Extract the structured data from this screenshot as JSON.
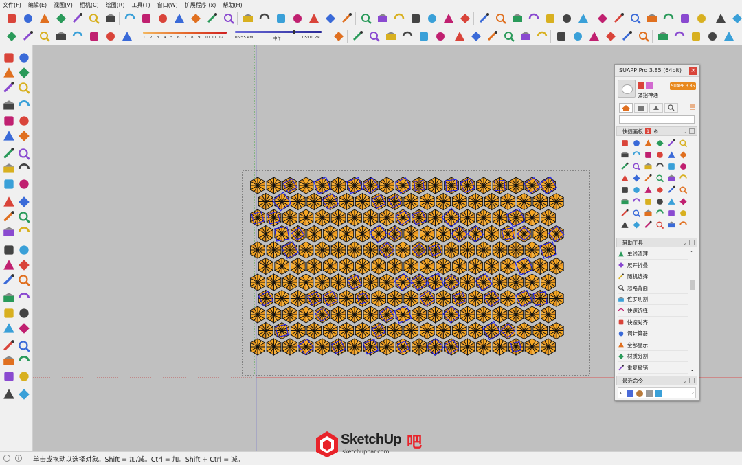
{
  "menu": [
    "文件(F)",
    "编辑(E)",
    "视图(V)",
    "相机(C)",
    "绘图(R)",
    "工具(T)",
    "窗口(W)",
    "扩展程序 (x)",
    "帮助(H)"
  ],
  "shadow_slider": {
    "hours": [
      "1",
      "2",
      "3",
      "4",
      "5",
      "6",
      "7",
      "8",
      "9",
      "10",
      "11",
      "12"
    ]
  },
  "time_slider": {
    "start": "06:55 AM",
    "mid": "中午",
    "end": "05:00 PM"
  },
  "status": {
    "hint": "单击或拖动以选择对象。Shift = 加/减。Ctrl = 加。Shift + Ctrl = 减。"
  },
  "suapp": {
    "title": "SUAPP Pro 3.85 (64bit)",
    "badge": "SUAPP 3.85",
    "user": "弹指神通",
    "section_quick": "快捷画板",
    "section_quick_num": "1",
    "section_aux": "辅助工具",
    "aux_items": [
      "单线清理",
      "展开折叠",
      "随机选择",
      "忽略背面",
      "佐罗切割",
      "快速选择",
      "快速对齐",
      "调计算器",
      "全部显示",
      "材质分割",
      "重复撤销"
    ],
    "section_recent": "最近命令"
  },
  "watermark": {
    "brand": "SketchUp",
    "suffix": "吧",
    "url": "sketchupbar.com"
  },
  "colors": {
    "orange": "#F5A623",
    "blue_edge": "#2222ee",
    "red_axis": "#e03030",
    "green_axis": "#2aa02a",
    "suapp_red": "#d9443a"
  }
}
